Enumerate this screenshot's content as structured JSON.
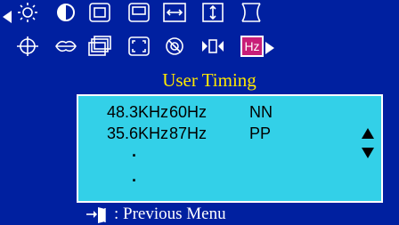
{
  "menu": {
    "title": "User Timing",
    "icons_row1": [
      "left-arrow-icon",
      "brightness-icon",
      "contrast-icon",
      "position-icon",
      "size-icon",
      "h-size-icon",
      "v-size-icon",
      "pincushion-icon"
    ],
    "icons_row2": [
      "rotation-icon",
      "color-icon",
      "recall-icon",
      "moire-icon",
      "degauss-icon",
      "language-icon",
      "hz-icon",
      "right-arrow-icon"
    ],
    "hz_label": "Hz"
  },
  "timings": [
    {
      "h_freq": "48.3KHz",
      "v_freq": "60Hz",
      "polarity": "NN"
    },
    {
      "h_freq": "35.6KHz",
      "v_freq": "87Hz",
      "polarity": "PP"
    }
  ],
  "more_dots": [
    ".",
    "."
  ],
  "footer": {
    "label": ": Previous Menu"
  },
  "colors": {
    "background": "#0020a0",
    "panel": "#33d0e8",
    "title": "#ffe800",
    "selected_icon": "#c81e78"
  }
}
